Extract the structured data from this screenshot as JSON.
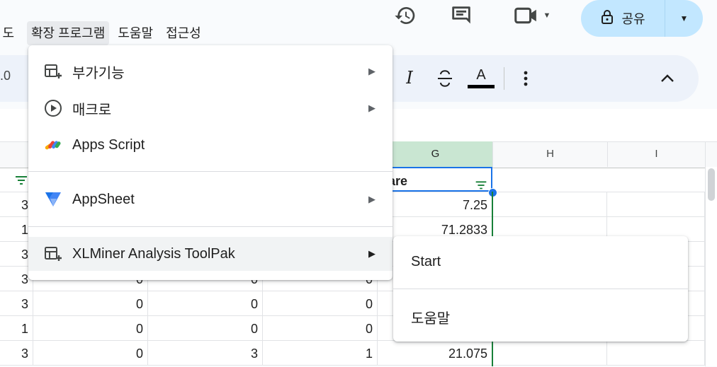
{
  "menubar": {
    "items": [
      {
        "label": "도구",
        "visible_label": "도구"
      },
      {
        "label": "확장 프로그램"
      },
      {
        "label": "도움말"
      },
      {
        "label": "접근성"
      }
    ]
  },
  "header": {
    "share_label": "공유",
    "icons": [
      "history-icon",
      "comment-icon",
      "meet-video-icon",
      "lock-icon"
    ]
  },
  "toolbar": {
    "visible_fragment": ".0",
    "icons": [
      "italic-icon",
      "strikethrough-icon",
      "text-color-icon",
      "more-vert-icon",
      "collapse-chevron-icon"
    ],
    "text_color_glyph": "A",
    "italic_glyph": "I"
  },
  "sheet": {
    "columns": [
      "G",
      "H",
      "I"
    ],
    "selected_column": "G",
    "header_cell": "are",
    "rows": [
      {
        "a": "3",
        "d": "",
        "e": "",
        "f": "",
        "g": "7.25"
      },
      {
        "a": "1",
        "d": "",
        "e": "",
        "f": "",
        "g": "71.2833"
      },
      {
        "a": "3",
        "d": "",
        "e": "",
        "f": "",
        "g": ""
      },
      {
        "a": "3",
        "d": "0",
        "e": "0",
        "f": "0",
        "g": ""
      },
      {
        "a": "3",
        "d": "0",
        "e": "0",
        "f": "0",
        "g": ""
      },
      {
        "a": "1",
        "d": "0",
        "e": "0",
        "f": "0",
        "g": ""
      },
      {
        "a": "3",
        "d": "0",
        "e": "3",
        "f": "1",
        "g": "21.075"
      }
    ]
  },
  "extensions_menu": {
    "items": [
      {
        "label": "부가기능",
        "icon": "addon-icon",
        "submenu": true
      },
      {
        "label": "매크로",
        "icon": "play-circle-icon",
        "submenu": true
      },
      {
        "label": "Apps Script",
        "icon": "apps-script-icon",
        "submenu": false
      },
      {
        "label": "AppSheet",
        "icon": "appsheet-icon",
        "submenu": true
      },
      {
        "label": "XLMiner Analysis ToolPak",
        "icon": "addon-icon",
        "submenu": true
      }
    ],
    "arrow_glyph": "▶"
  },
  "xlminer_submenu": {
    "items": [
      {
        "label": "Start"
      },
      {
        "label": "도움말"
      }
    ]
  },
  "colors": {
    "share_bg": "#c2e7ff",
    "selected_col": "#c9e6d2",
    "select_blue": "#1a73e8",
    "filter_green": "#188038"
  }
}
